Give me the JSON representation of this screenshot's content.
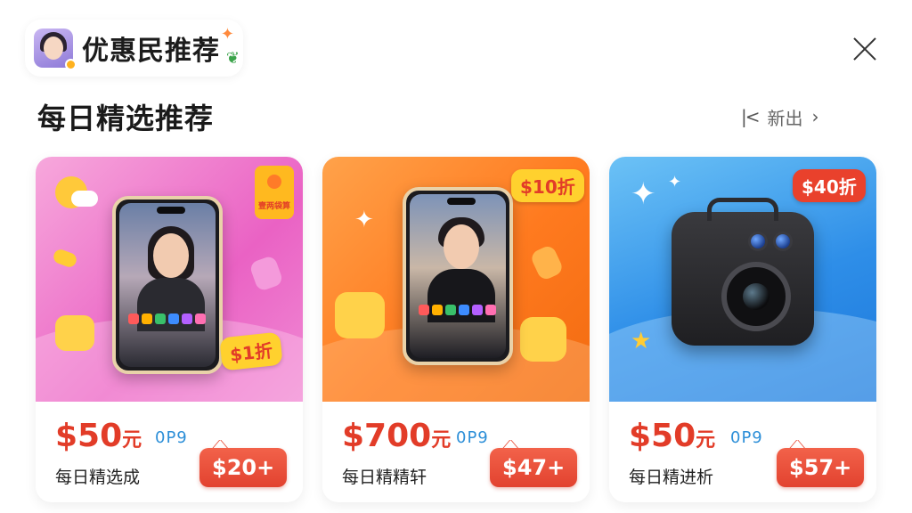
{
  "header": {
    "brand_title": "优惠民推荐",
    "close_icon": "close-icon"
  },
  "section": {
    "title": "每日精选推荐",
    "pager_first": "|<",
    "pager_next_label": "新出",
    "pager_next": "›"
  },
  "colors": {
    "price_red": "#e23c28",
    "coupon_red": "#e2422f",
    "code_blue": "#2d8fd8"
  },
  "products": [
    {
      "price": "$50",
      "price_unit": "元",
      "code": "0P9",
      "subtitle": "每日精选成",
      "coupon": "$20+",
      "badge": "$1折",
      "bag_label": "壹两袋算",
      "image": "phone-woman"
    },
    {
      "price": "$700",
      "price_unit": "元",
      "code": "0P9",
      "subtitle": "每日精精轩",
      "coupon": "$47+",
      "badge": "$10折",
      "image": "phone-man"
    },
    {
      "price": "$50",
      "price_unit": "元",
      "code": "0P9",
      "subtitle": "每日精进析",
      "coupon": "$57+",
      "badge": "$40折",
      "image": "camera"
    }
  ]
}
